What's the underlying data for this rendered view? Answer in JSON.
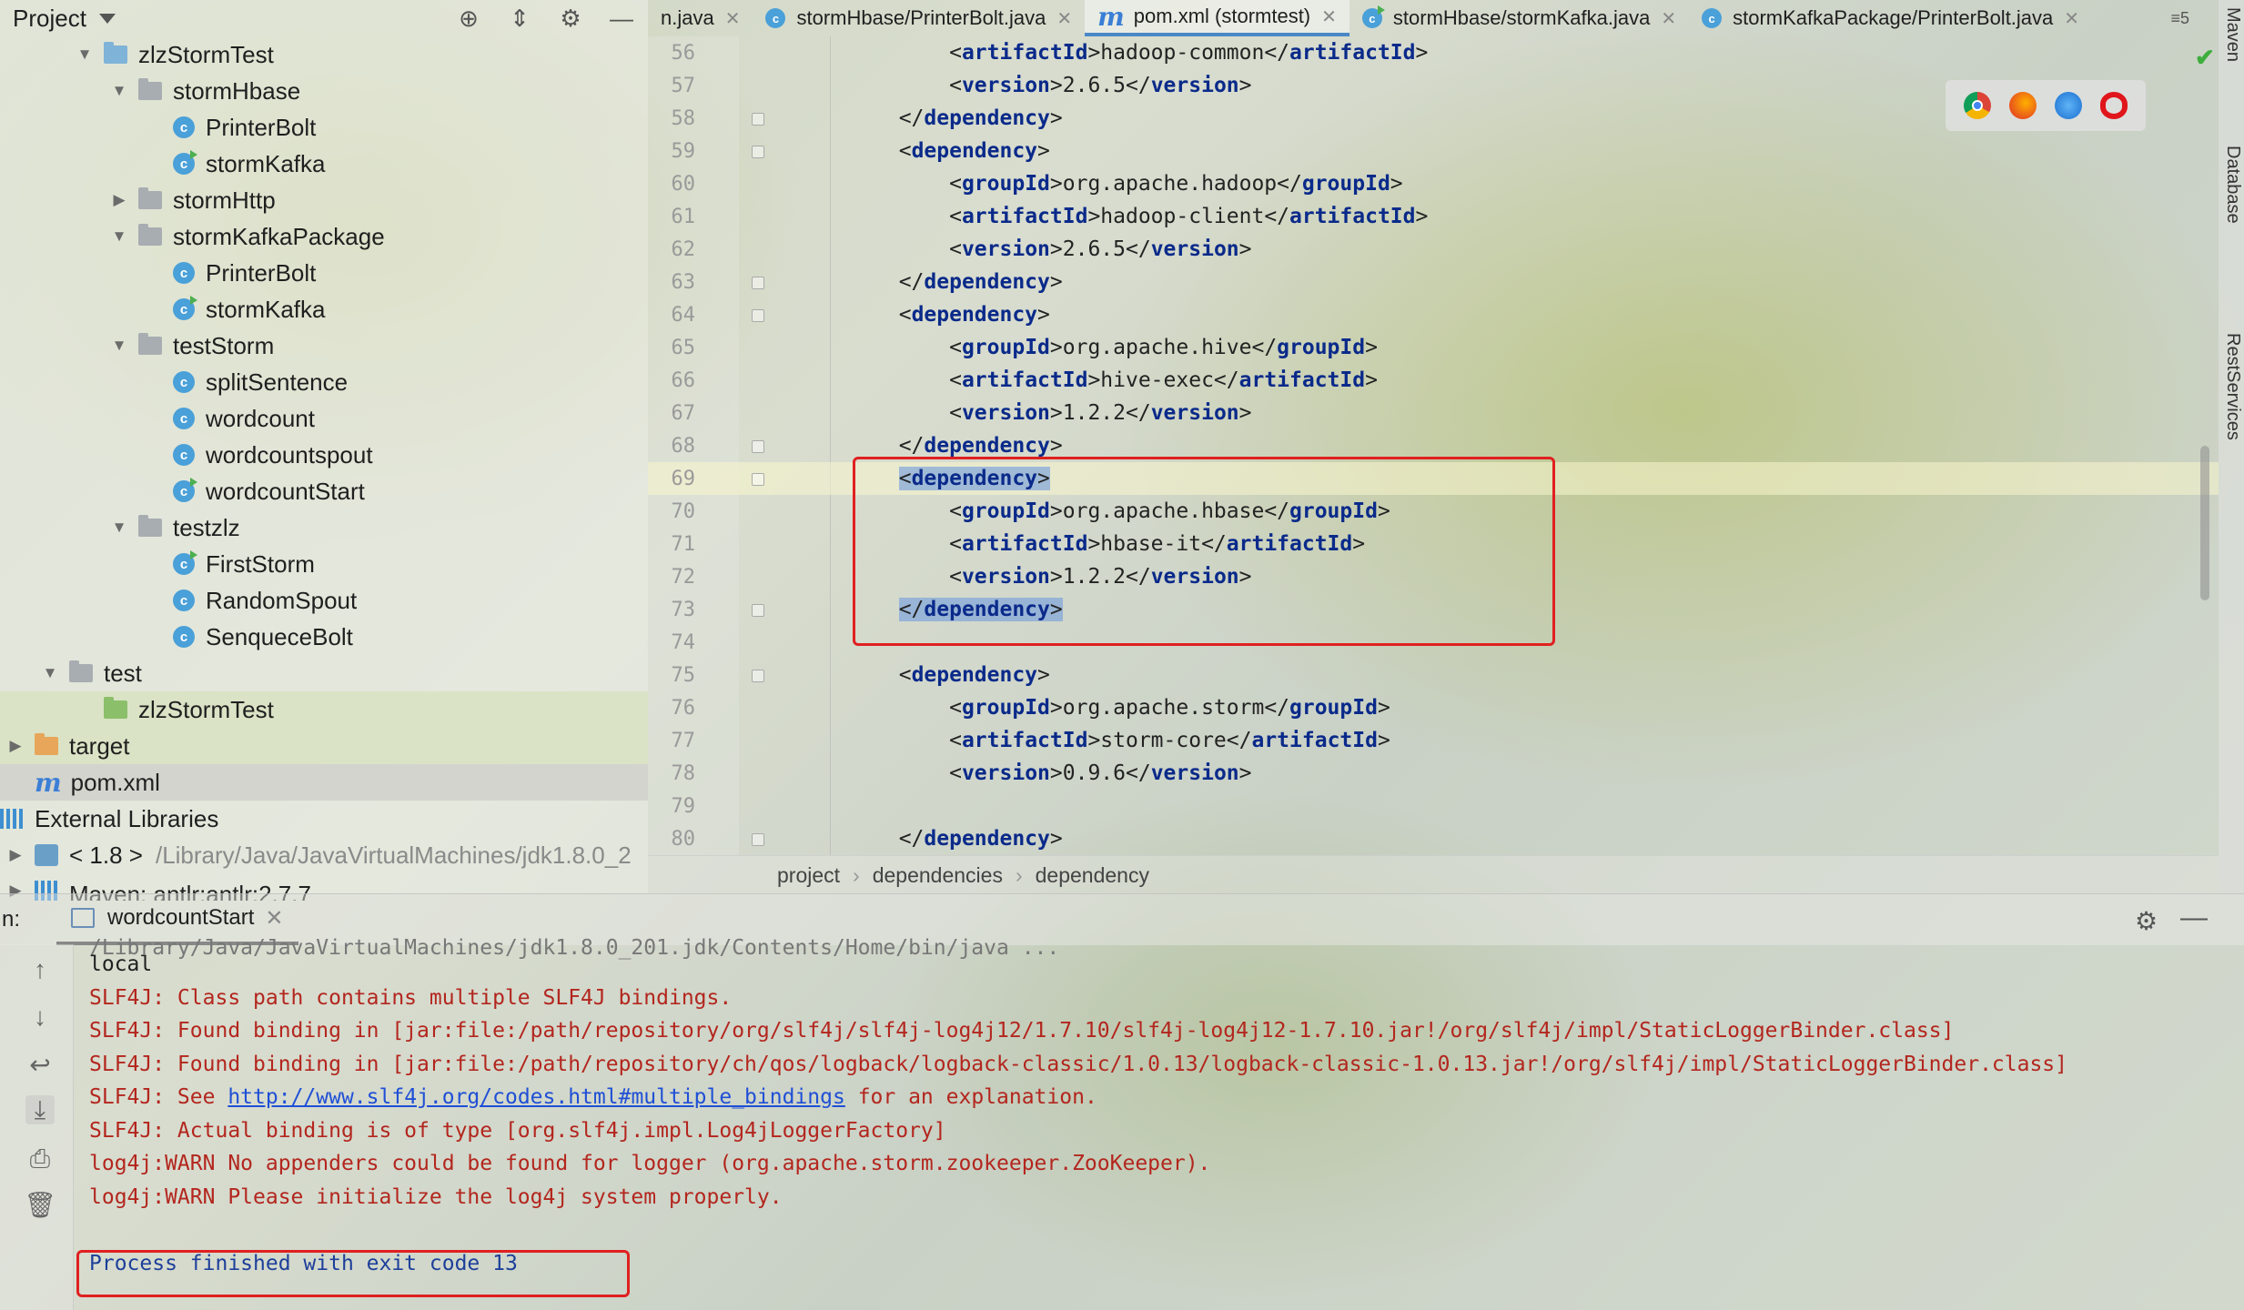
{
  "project": {
    "title": "Project",
    "tree": [
      {
        "label": "zlzStormTest",
        "kind": "folder-blue",
        "indent": 2,
        "arrow": "down"
      },
      {
        "label": "stormHbase",
        "kind": "folder-gray",
        "indent": 3,
        "arrow": "down"
      },
      {
        "label": "PrinterBolt",
        "kind": "class",
        "indent": 4,
        "arrow": ""
      },
      {
        "label": "stormKafka",
        "kind": "class-run",
        "indent": 4,
        "arrow": ""
      },
      {
        "label": "stormHttp",
        "kind": "folder-gray",
        "indent": 3,
        "arrow": "right"
      },
      {
        "label": "stormKafkaPackage",
        "kind": "folder-gray",
        "indent": 3,
        "arrow": "down"
      },
      {
        "label": "PrinterBolt",
        "kind": "class",
        "indent": 4,
        "arrow": ""
      },
      {
        "label": "stormKafka",
        "kind": "class-run",
        "indent": 4,
        "arrow": ""
      },
      {
        "label": "testStorm",
        "kind": "folder-gray",
        "indent": 3,
        "arrow": "down"
      },
      {
        "label": "splitSentence",
        "kind": "class",
        "indent": 4,
        "arrow": ""
      },
      {
        "label": "wordcount",
        "kind": "class",
        "indent": 4,
        "arrow": ""
      },
      {
        "label": "wordcountspout",
        "kind": "class",
        "indent": 4,
        "arrow": ""
      },
      {
        "label": "wordcountStart",
        "kind": "class-run",
        "indent": 4,
        "arrow": ""
      },
      {
        "label": "testzlz",
        "kind": "folder-gray",
        "indent": 3,
        "arrow": "down"
      },
      {
        "label": "FirstStorm",
        "kind": "class-run",
        "indent": 4,
        "arrow": ""
      },
      {
        "label": "RandomSpout",
        "kind": "class",
        "indent": 4,
        "arrow": ""
      },
      {
        "label": "SenqueceBolt",
        "kind": "class",
        "indent": 4,
        "arrow": ""
      },
      {
        "label": "test",
        "kind": "folder-gray",
        "indent": 1,
        "arrow": "down"
      },
      {
        "label": "zlzStormTest",
        "kind": "folder-green",
        "indent": 2,
        "arrow": "",
        "selected": true
      },
      {
        "label": "target",
        "kind": "folder-orange",
        "indent": 0,
        "arrow": "right",
        "selected": true
      },
      {
        "label": "pom.xml",
        "kind": "maven",
        "indent": 0,
        "arrow": "",
        "selected2": true
      },
      {
        "label": "External Libraries",
        "kind": "libs",
        "indent": -1,
        "arrow": ""
      },
      {
        "label": "< 1.8 >",
        "kind": "jdk",
        "indent": 0,
        "arrow": "right",
        "extra": "/Library/Java/JavaVirtualMachines/jdk1.8.0_2"
      },
      {
        "label": "Maven: antlr:antlr:2.7.7",
        "kind": "libs",
        "indent": 0,
        "arrow": "right",
        "cut": true
      }
    ]
  },
  "tabs": {
    "items": [
      {
        "label": "n.java",
        "icon": "none"
      },
      {
        "label": "stormHbase/PrinterBolt.java",
        "icon": "class"
      },
      {
        "label": "pom.xml (stormtest)",
        "icon": "maven",
        "active": true
      },
      {
        "label": "stormHbase/stormKafka.java",
        "icon": "class-run"
      },
      {
        "label": "stormKafkaPackage/PrinterBolt.java",
        "icon": "class"
      }
    ],
    "overflow": "≡5"
  },
  "right_strip": {
    "maven": "Maven",
    "database": "Database",
    "rest": "RestServices"
  },
  "editor": {
    "lines": [
      {
        "n": "56",
        "indent": "    ",
        "tag": "artifactId",
        "text": "hadoop-common"
      },
      {
        "n": "57",
        "indent": "    ",
        "tag": "version",
        "text": "2.6.5"
      },
      {
        "n": "58",
        "indent": "",
        "close": "dependency",
        "fold": true
      },
      {
        "n": "59",
        "indent": "",
        "open": "dependency",
        "fold": true
      },
      {
        "n": "60",
        "indent": "    ",
        "tag": "groupId",
        "text": "org.apache.hadoop"
      },
      {
        "n": "61",
        "indent": "    ",
        "tag": "artifactId",
        "text": "hadoop-client"
      },
      {
        "n": "62",
        "indent": "    ",
        "tag": "version",
        "text": "2.6.5"
      },
      {
        "n": "63",
        "indent": "",
        "close": "dependency",
        "fold": true
      },
      {
        "n": "64",
        "indent": "",
        "open": "dependency",
        "fold": true
      },
      {
        "n": "65",
        "indent": "    ",
        "tag": "groupId",
        "text": "org.apache.hive"
      },
      {
        "n": "66",
        "indent": "    ",
        "tag": "artifactId",
        "text": "hive-exec"
      },
      {
        "n": "67",
        "indent": "    ",
        "tag": "version",
        "text": "1.2.2"
      },
      {
        "n": "68",
        "indent": "",
        "close": "dependency",
        "fold": true
      },
      {
        "n": "69",
        "indent": "",
        "open": "dependency",
        "fold": true,
        "current": true,
        "highlight": true
      },
      {
        "n": "70",
        "indent": "    ",
        "tag": "groupId",
        "text": "org.apache.hbase"
      },
      {
        "n": "71",
        "indent": "    ",
        "tag": "artifactId",
        "text": "hbase-it"
      },
      {
        "n": "72",
        "indent": "    ",
        "tag": "version",
        "text": "1.2.2"
      },
      {
        "n": "73",
        "indent": "",
        "close": "dependency",
        "fold": true,
        "highlight": true
      },
      {
        "n": "74",
        "indent": ""
      },
      {
        "n": "75",
        "indent": "",
        "open": "dependency",
        "fold": true
      },
      {
        "n": "76",
        "indent": "    ",
        "tag": "groupId",
        "text": "org.apache.storm"
      },
      {
        "n": "77",
        "indent": "    ",
        "tag": "artifactId",
        "text": "storm-core"
      },
      {
        "n": "78",
        "indent": "    ",
        "tag": "version",
        "text": "0.9.6"
      },
      {
        "n": "79",
        "indent": ""
      },
      {
        "n": "80",
        "indent": "",
        "close": "dependency",
        "fold": true
      }
    ]
  },
  "breadcrumb": [
    "project",
    "dependencies",
    "dependency"
  ],
  "run": {
    "label": "n:",
    "tab": "wordcountStart",
    "cut_line": "/Library/Java/JavaVirtualMachines/jdk1.8.0_201.jdk/Contents/Home/bin/java ...",
    "lines": [
      {
        "text": "local",
        "style": "plain"
      },
      {
        "text": "SLF4J: Class path contains multiple SLF4J bindings.",
        "style": "err"
      },
      {
        "text": "SLF4J: Found binding in [jar:file:/path/repository/org/slf4j/slf4j-log4j12/1.7.10/slf4j-log4j12-1.7.10.jar!/org/slf4j/impl/StaticLoggerBinder.class]",
        "style": "err"
      },
      {
        "text": "SLF4J: Found binding in [jar:file:/path/repository/ch/qos/logback/logback-classic/1.0.13/logback-classic-1.0.13.jar!/org/slf4j/impl/StaticLoggerBinder.class]",
        "style": "err"
      },
      {
        "pre": "SLF4J: See ",
        "link": "http://www.slf4j.org/codes.html#multiple_bindings",
        "post": " for an explanation.",
        "style": "err"
      },
      {
        "text": "SLF4J: Actual binding is of type [org.slf4j.impl.Log4jLoggerFactory]",
        "style": "err"
      },
      {
        "text": "log4j:WARN No appenders could be found for logger (org.apache.storm.zookeeper.ZooKeeper).",
        "style": "err"
      },
      {
        "text": "log4j:WARN Please initialize the log4j system properly.",
        "style": "err"
      },
      {
        "text": "",
        "style": "plain"
      },
      {
        "text": "Process finished with exit code 13",
        "style": "blue"
      }
    ]
  }
}
